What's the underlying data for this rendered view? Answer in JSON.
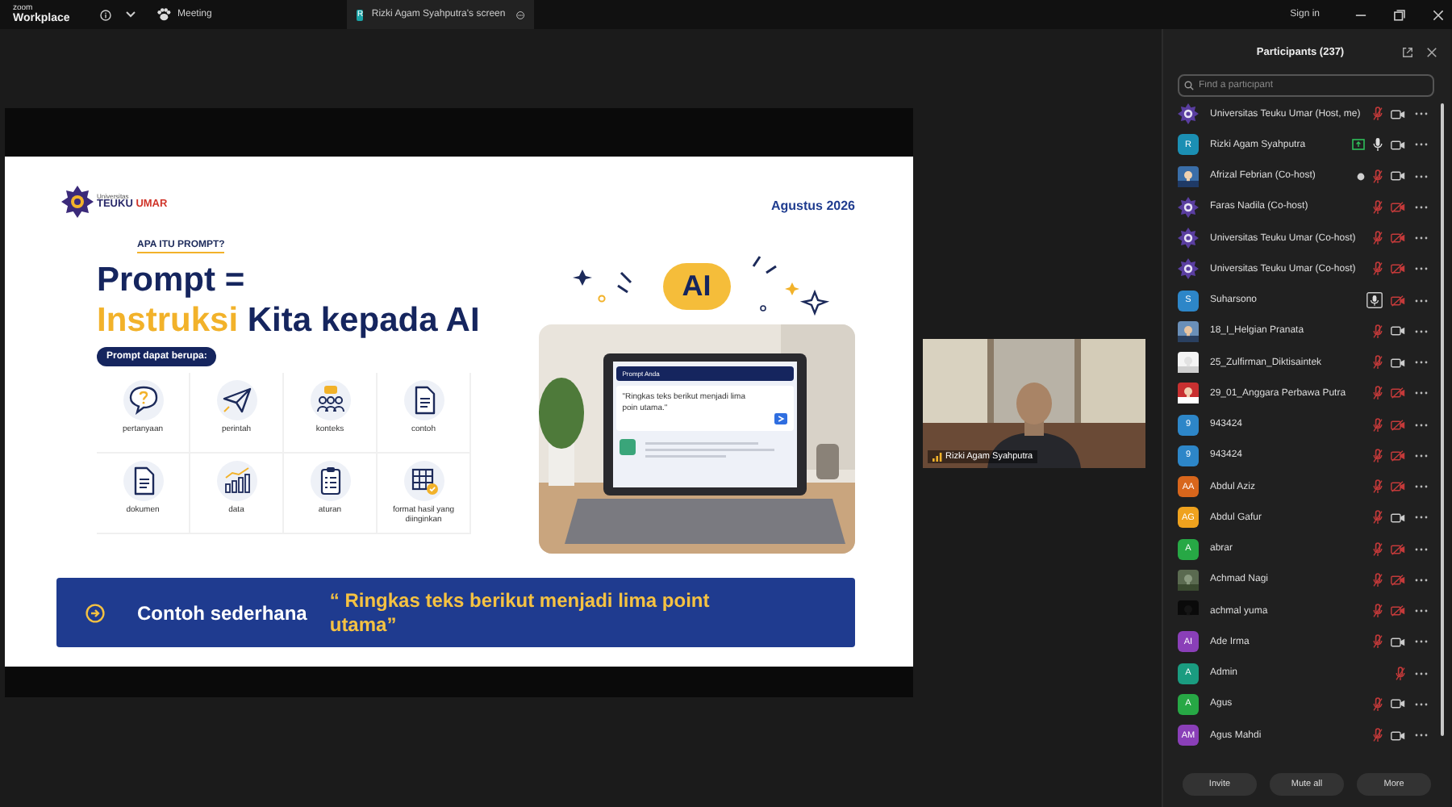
{
  "titlebar": {
    "brand_top": "zoom",
    "brand": "Workplace",
    "meeting": "Meeting",
    "share_tab": {
      "initial": "R",
      "label": "Rizki Agam Syahputra's screen"
    },
    "sign_in": "Sign in"
  },
  "slide": {
    "logo": {
      "small": "Universitas",
      "name_part1": "TEUKU",
      "name_part2": "UMAR"
    },
    "date": "Agustus 2026",
    "kicker": "APA ITU PROMPT?",
    "title_line1": "Prompt =",
    "title_line2": [
      {
        "text": "Instruksi",
        "accent": true
      },
      {
        "text": "Kita kepada AI",
        "accent": false
      }
    ],
    "pill": "Prompt dapat berupa:",
    "items": [
      {
        "label": "pertanyaan",
        "kind": "question"
      },
      {
        "label": "perintah",
        "kind": "send"
      },
      {
        "label": "konteks",
        "kind": "people"
      },
      {
        "label": "contoh",
        "kind": "document"
      },
      {
        "label": "dokumen",
        "kind": "file"
      },
      {
        "label": "data",
        "kind": "chart"
      },
      {
        "label": "aturan",
        "kind": "clipboard"
      },
      {
        "label": "format hasil yang diinginkan",
        "kind": "table"
      }
    ],
    "ai_bubble": "AI",
    "chat": {
      "header": "Prompt Anda",
      "text": "\"Ringkas teks berikut menjadi lima poin utama.\""
    },
    "banner": {
      "label": "Contoh sederhana",
      "quote": "“ Ringkas teks berikut menjadi lima point utama”"
    }
  },
  "video": {
    "name": "Rizki Agam Syahputra"
  },
  "participants": {
    "title": "Participants (237)",
    "search": {
      "placeholder": "Find a participant"
    },
    "rows": [
      {
        "name": "Universitas Teuku Umar (Host, me)",
        "avatar": {
          "kind": "logo"
        },
        "muted": true,
        "video_off": false
      },
      {
        "name": "Rizki Agam Syahputra",
        "avatar": {
          "kind": "initials",
          "text": "R",
          "color": "#1b8fb3"
        },
        "sharing": true,
        "muted": false,
        "speaking": false,
        "video_off": false
      },
      {
        "name": "Afrizal Febrian (Co-host)",
        "dot": true,
        "muted": true,
        "video_off": false
      },
      {
        "name": "Faras Nadila (Co-host)",
        "avatar": {
          "kind": "logo"
        },
        "muted": true,
        "video_off": true
      },
      {
        "name": "Universitas Teuku Umar (Co-host)",
        "avatar": {
          "kind": "logo"
        },
        "muted": true,
        "video_off": true
      },
      {
        "name": "Universitas Teuku Umar (Co-host)",
        "avatar": {
          "kind": "logo"
        },
        "muted": true,
        "video_off": true
      },
      {
        "name": "Suharsono",
        "avatar": {
          "kind": "initials",
          "text": "S",
          "color": "#2d86c8"
        },
        "muted": false,
        "speaking": true,
        "video_off": true
      },
      {
        "name": "18_I_Helgian Pranata",
        "muted": true,
        "video_off": false
      },
      {
        "name": "25_Zulfirman_Diktisaintek",
        "muted": true,
        "video_off": false
      },
      {
        "name": "29_01_Anggara Perbawa Putra",
        "muted": true,
        "video_off": true
      },
      {
        "name": "943424",
        "avatar": {
          "kind": "initials",
          "text": "9",
          "color": "#2d86c8"
        },
        "muted": true,
        "video_off": true
      },
      {
        "name": "943424",
        "avatar": {
          "kind": "initials",
          "text": "9",
          "color": "#2d86c8"
        },
        "muted": true,
        "video_off": true
      },
      {
        "name": "Abdul Aziz",
        "avatar": {
          "kind": "initials",
          "text": "AA",
          "color": "#d8661c"
        },
        "muted": true,
        "video_off": true
      },
      {
        "name": "Abdul Gafur",
        "avatar": {
          "kind": "initials",
          "text": "AG",
          "color": "#efa21e"
        },
        "muted": true,
        "video_off": false
      },
      {
        "name": "abrar",
        "avatar": {
          "kind": "initials",
          "text": "A",
          "color": "#27a845"
        },
        "muted": true,
        "video_off": true
      },
      {
        "name": "Achmad Nagi",
        "muted": true,
        "video_off": true
      },
      {
        "name": "achmal yuma",
        "muted": true,
        "video_off": true
      },
      {
        "name": "Ade Irma",
        "avatar": {
          "kind": "initials",
          "text": "AI",
          "color": "#8a3fb8"
        },
        "muted": true,
        "video_off": false
      },
      {
        "name": "Admin",
        "avatar": {
          "kind": "initials",
          "text": "A",
          "color": "#1a9c80"
        },
        "muted": true
      },
      {
        "name": "Agus",
        "avatar": {
          "kind": "initials",
          "text": "A",
          "color": "#27a845"
        },
        "muted": true,
        "video_off": false
      },
      {
        "name": "Agus Mahdi",
        "avatar": {
          "kind": "initials",
          "text": "AM",
          "color": "#8a3fb8"
        },
        "muted": true,
        "video_off": false
      }
    ],
    "buttons": [
      "Invite",
      "Mute all",
      "More"
    ]
  }
}
